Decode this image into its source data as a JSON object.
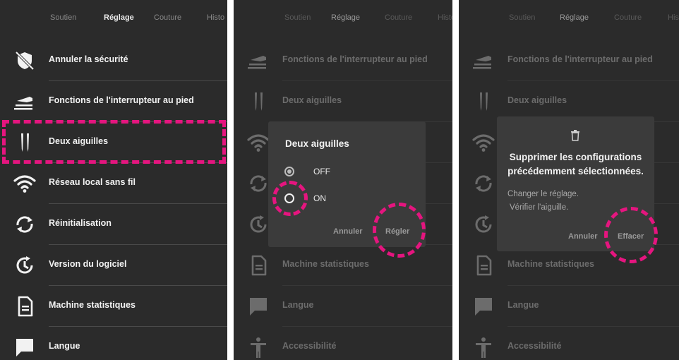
{
  "tabs": [
    "Soutien",
    "Réglage",
    "Couture",
    "Historique"
  ],
  "tab_visible": [
    "Soutien",
    "Réglage",
    "Couture",
    "Histo"
  ],
  "panel1": {
    "items": [
      {
        "label": "Annuler la sécurité",
        "icon": "security-off-icon"
      },
      {
        "label": "Fonctions de l'interrupteur au pied",
        "icon": "foot-switch-icon"
      },
      {
        "label": "Deux aiguilles",
        "icon": "twin-needle-icon"
      },
      {
        "label": "Réseau local sans fil",
        "icon": "wifi-icon"
      },
      {
        "label": "Réinitialisation",
        "icon": "reset-icon"
      },
      {
        "label": "Version du logiciel",
        "icon": "software-version-icon"
      },
      {
        "label": "Machine statistiques",
        "icon": "document-icon"
      },
      {
        "label": "Langue",
        "icon": "language-icon"
      }
    ]
  },
  "panel2": {
    "items": [
      {
        "label": "Fonctions de l'interrupteur au pied"
      },
      {
        "label": "Deux aiguilles"
      },
      {
        "label": ""
      },
      {
        "label": ""
      },
      {
        "label": ""
      },
      {
        "label": "Machine statistiques"
      },
      {
        "label": "Langue"
      },
      {
        "label": "Accessibilité"
      }
    ],
    "dialog": {
      "title": "Deux aiguilles",
      "options": [
        {
          "label": "OFF",
          "selected": true
        },
        {
          "label": "ON",
          "selected": false
        }
      ],
      "cancel": "Annuler",
      "confirm": "Régler"
    }
  },
  "panel3": {
    "items": [
      {
        "label": "Fonctions de l'interrupteur au pied"
      },
      {
        "label": "Deux aiguilles"
      },
      {
        "label": ""
      },
      {
        "label": ""
      },
      {
        "label": ""
      },
      {
        "label": "Machine statistiques"
      },
      {
        "label": "Langue"
      },
      {
        "label": "Accessibilité"
      }
    ],
    "dialog": {
      "title_line1": "Supprimer les configurations",
      "title_line2": "précédemment sélectionnées.",
      "body_line1": "Changer le réglage.",
      "body_line2": "Vérifier l'aiguille.",
      "cancel": "Annuler",
      "confirm": "Effacer"
    }
  },
  "colors": {
    "background": "#2b2b2b",
    "dialog": "#3b3b3b",
    "highlight": "#e5157f",
    "text": "#f2f2f2"
  }
}
